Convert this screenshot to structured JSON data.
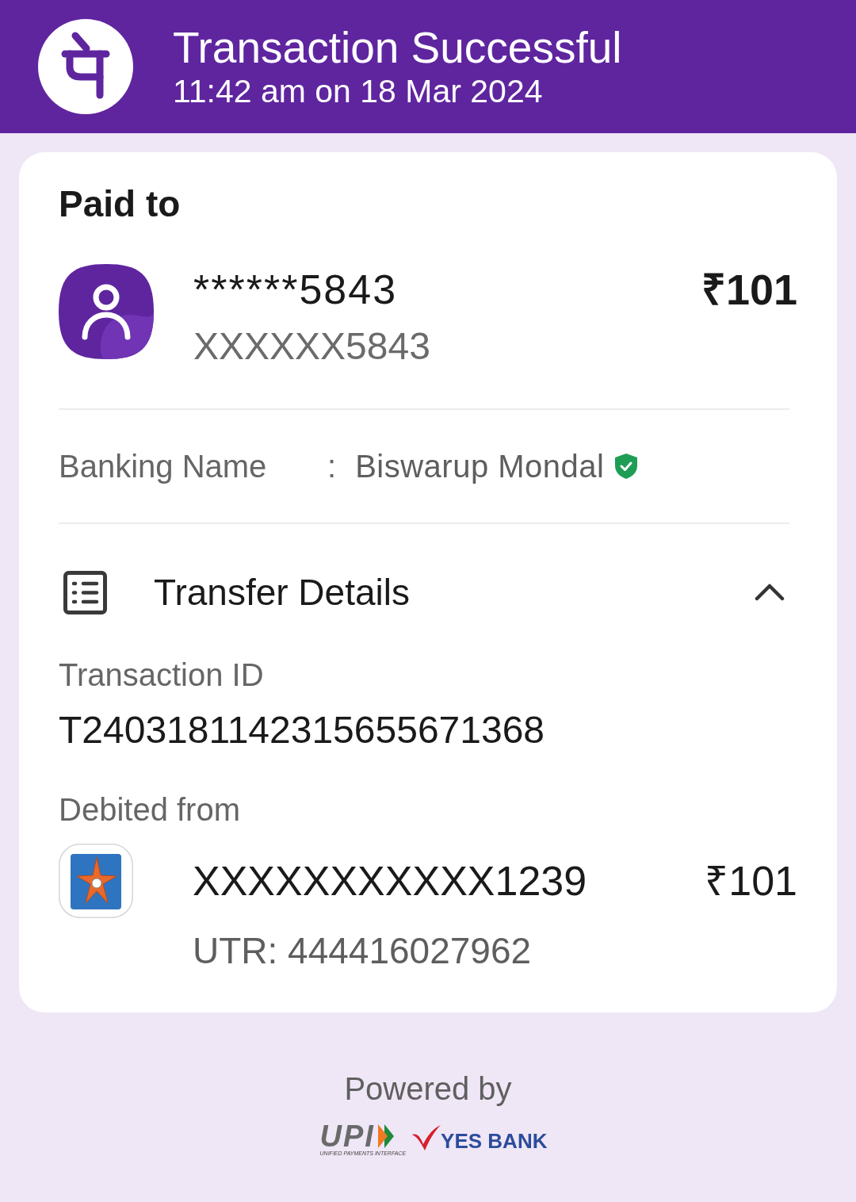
{
  "header": {
    "title": "Transaction Successful",
    "subtitle": "11:42 am on 18 Mar 2024"
  },
  "paid_to": {
    "heading": "Paid to",
    "name": "******5843",
    "account": "XXXXXX5843",
    "amount": "₹101"
  },
  "banking_name": {
    "label": "Banking Name",
    "separator": ":",
    "value": "Biswarup Mondal",
    "verified": true
  },
  "transfer_details": {
    "title": "Transfer Details",
    "expanded": true,
    "transaction_id_label": "Transaction ID",
    "transaction_id": "T2403181142315655671368",
    "debited_from_label": "Debited from",
    "account": "XXXXXXXXXXX1239",
    "amount": "₹101",
    "utr": "UTR: 444416027962"
  },
  "footer": {
    "powered_by": "Powered by",
    "upi_logo": "UPI",
    "upi_tagline": "UNIFIED PAYMENTS INTERFACE",
    "bank_logo": "YES BANK"
  }
}
